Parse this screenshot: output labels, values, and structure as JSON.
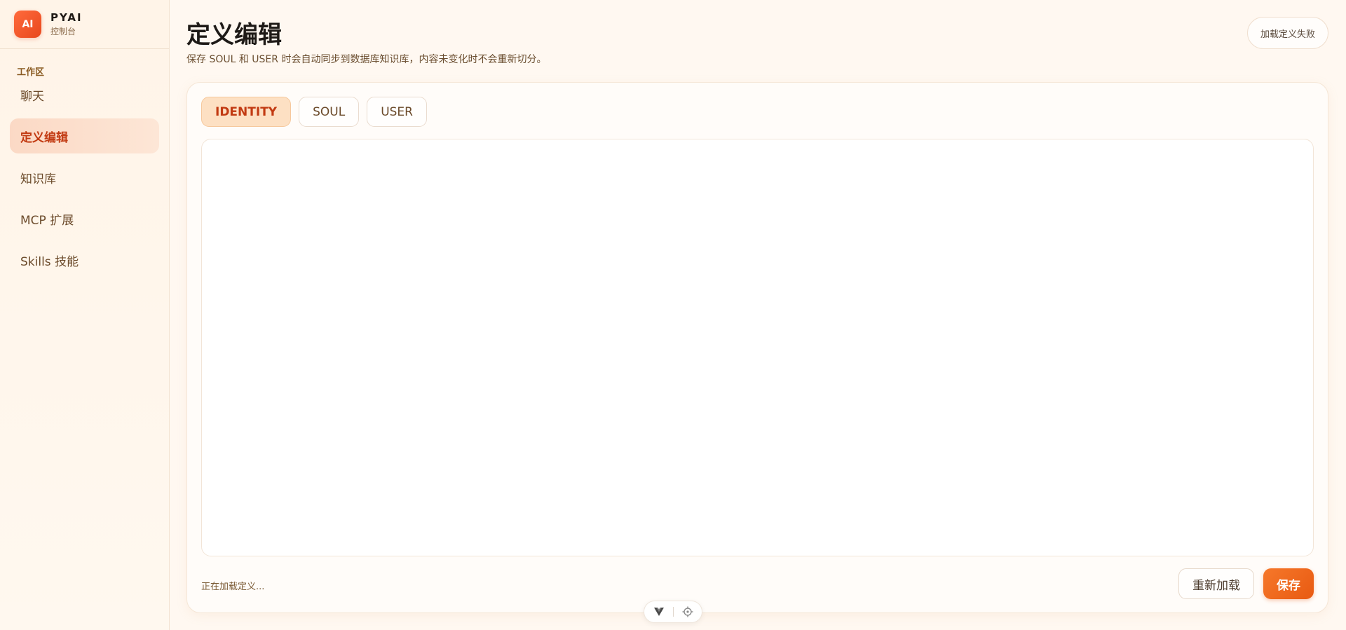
{
  "brand": {
    "logo_text": "AI",
    "name": "PYAI",
    "subtitle": "控制台"
  },
  "sidebar": {
    "section_label": "工作区",
    "items": [
      {
        "label": "聊天",
        "active": false
      },
      {
        "label": "定义编辑",
        "active": true
      },
      {
        "label": "知识库",
        "active": false
      },
      {
        "label": "MCP 扩展",
        "active": false
      },
      {
        "label": "Skills 技能",
        "active": false
      }
    ]
  },
  "header": {
    "title": "定义编辑",
    "subtitle": "保存 SOUL 和 USER 时会自动同步到数据库知识库，内容未变化时不会重新切分。",
    "status_pill": "加载定义失败"
  },
  "editor": {
    "tabs": [
      {
        "label": "IDENTITY",
        "active": true
      },
      {
        "label": "SOUL",
        "active": false
      },
      {
        "label": "USER",
        "active": false
      }
    ],
    "content": "",
    "status_text": "正在加载定义...",
    "reload_label": "重新加载",
    "save_label": "保存"
  },
  "mini_toolbar": {
    "icons": [
      "vue-devtools-icon",
      "target-icon"
    ]
  },
  "colors": {
    "accent": "#e85a12",
    "active_text": "#c23a12",
    "active_bg": "#fde0c3",
    "background": "#fff8f1"
  }
}
